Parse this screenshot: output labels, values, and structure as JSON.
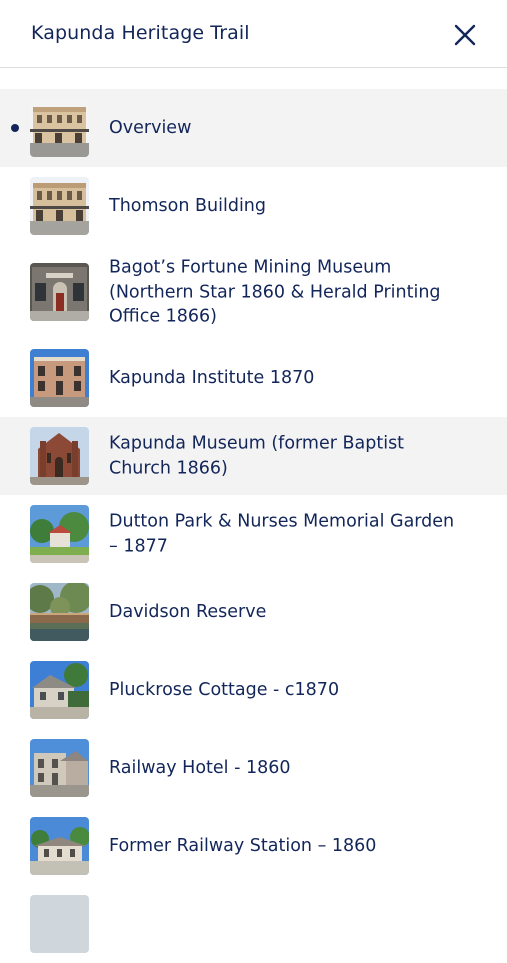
{
  "header": {
    "title": "Kapunda Heritage Trail",
    "close_icon": "close-icon"
  },
  "colors": {
    "text": "#13265a",
    "active_background": "#f3f3f3",
    "divider": "#dddddd"
  },
  "items": [
    {
      "label": "Overview",
      "thumb": "building-sandstone",
      "active": true,
      "shaded": true
    },
    {
      "label": "Thomson Building",
      "thumb": "building-sandstone",
      "active": false,
      "shaded": false
    },
    {
      "label": "Bagot’s Fortune Mining Museum (Northern Star 1860 & Herald Printing Office 1866)",
      "thumb": "building-shopfront",
      "active": false,
      "shaded": false
    },
    {
      "label": "Kapunda Institute 1870",
      "thumb": "building-institute",
      "active": false,
      "shaded": false
    },
    {
      "label": "Kapunda Museum (former Baptist Church 1866)",
      "thumb": "building-church",
      "active": false,
      "shaded": true
    },
    {
      "label": "Dutton Park & Nurses Memorial Garden – 1877",
      "thumb": "park-trees",
      "active": false,
      "shaded": false
    },
    {
      "label": "Davidson Reserve",
      "thumb": "reserve-bridge",
      "active": false,
      "shaded": false
    },
    {
      "label": "Pluckrose Cottage - c1870",
      "thumb": "cottage",
      "active": false,
      "shaded": false
    },
    {
      "label": "Railway Hotel - 1860",
      "thumb": "hotel",
      "active": false,
      "shaded": false
    },
    {
      "label": "Former Railway Station – 1860",
      "thumb": "station",
      "active": false,
      "shaded": false
    }
  ]
}
